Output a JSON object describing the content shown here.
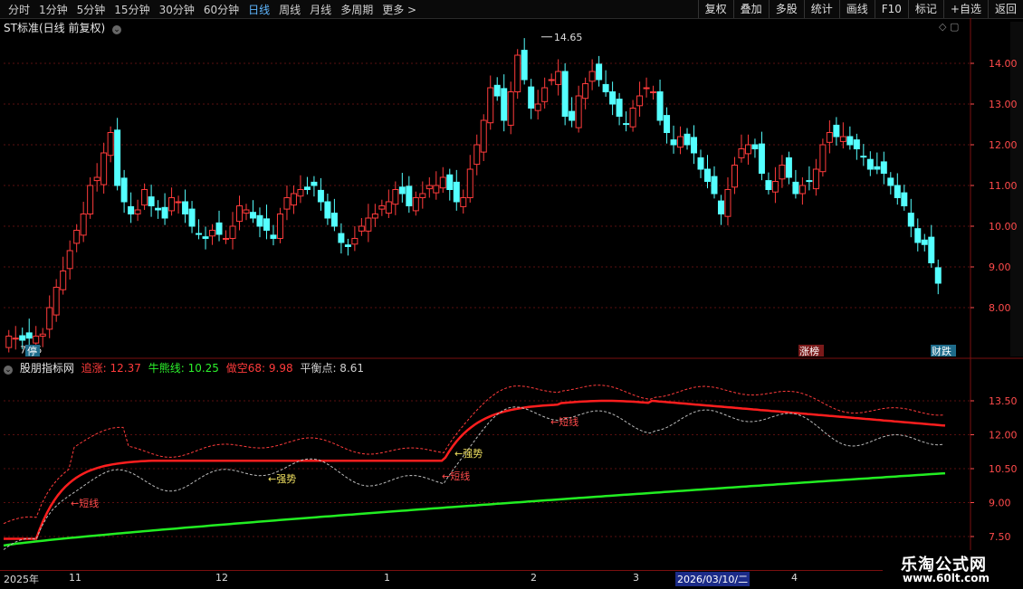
{
  "topbar": {
    "periods": [
      "分时",
      "1分钟",
      "5分钟",
      "15分钟",
      "30分钟",
      "60分钟",
      "日线",
      "周线",
      "月线",
      "多周期",
      "更多 >"
    ],
    "active_period": "日线",
    "tools": [
      "复权",
      "叠加",
      "多股",
      "统计",
      "画线",
      "F10",
      "标记",
      "+自选",
      "返回"
    ]
  },
  "main_chart": {
    "title": "ST标准(日线 前复权)",
    "high_label": "14.65",
    "low_label": "7.15",
    "y_ticks": [
      "14.00",
      "13.00",
      "12.00",
      "11.00",
      "10.00",
      "9.00",
      "8.00"
    ],
    "tags": {
      "left": "停",
      "zhangbang": "涨榜",
      "caidie": "财跌"
    }
  },
  "indicator": {
    "name": "股朋指标网",
    "zhuizhang": "追涨: 12.37",
    "niuxiong": "牛熊线: 10.25",
    "zuokong": "做空68: 9.98",
    "pinghengdian": "平衡点: 8.61",
    "y_ticks": [
      "13.50",
      "12.00",
      "10.50",
      "9.00",
      "7.50"
    ],
    "annotations": {
      "duanxian1": "←短线",
      "qiangshi1": "←强势",
      "duanxian2": "←短线",
      "qiangshi2": "←强势",
      "duanxian3": "←短线"
    }
  },
  "datebar": {
    "labels": [
      "2025年",
      "11",
      "12",
      "1",
      "2",
      "3",
      "4"
    ],
    "selected_date": "2026/03/10/二"
  },
  "colors": {
    "up": "#ff3b3b",
    "down": "#54ffff",
    "bull_line": "#22ee22",
    "chase_line": "#ff1e1e",
    "grid": "#5a0f0f"
  },
  "watermark": {
    "line1": "乐淘公式网",
    "line2": "www.60lt.com"
  }
}
